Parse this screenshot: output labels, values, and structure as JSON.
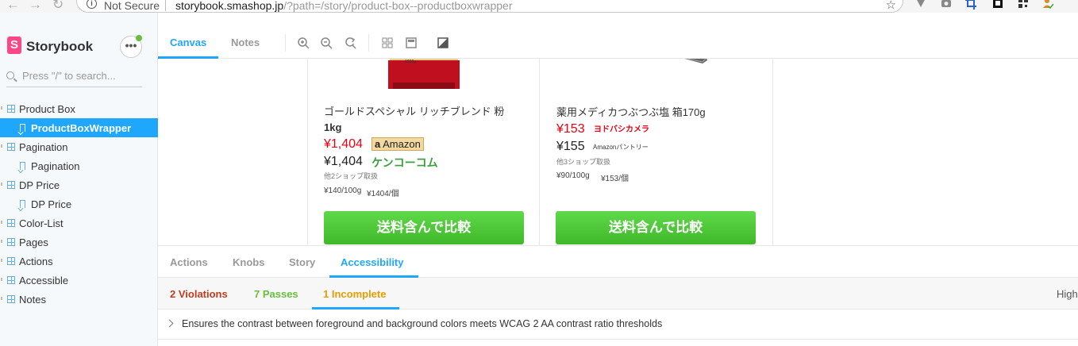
{
  "browser": {
    "security_label": "Not Secure",
    "url_host": "storybook.smashop.jp",
    "url_path": "/?path=/story/product-box--productboxwrapper"
  },
  "sidebar": {
    "title": "Storybook",
    "logo_letter": "S",
    "search_placeholder": "Press \"/\" to search...",
    "items": [
      {
        "label": "Product Box",
        "type": "component"
      },
      {
        "label": "ProductBoxWrapper",
        "type": "story",
        "active": true
      },
      {
        "label": "Pagination",
        "type": "component"
      },
      {
        "label": "Pagination",
        "type": "story"
      },
      {
        "label": "DP Price",
        "type": "component"
      },
      {
        "label": "DP Price",
        "type": "story"
      },
      {
        "label": "Color-List",
        "type": "component"
      },
      {
        "label": "Pages",
        "type": "component"
      },
      {
        "label": "Actions",
        "type": "component"
      },
      {
        "label": "Accessible",
        "type": "component"
      },
      {
        "label": "Notes",
        "type": "component"
      }
    ]
  },
  "toolbar": {
    "tabs": [
      "Canvas",
      "Notes"
    ],
    "active_tab": "Canvas"
  },
  "products": [
    {
      "name_line1": "ゴールドスペシャル リッチブレンド 粉",
      "name_line2": "1kg",
      "best_price": "¥1,404",
      "best_shop": "Amazon",
      "second_price": "¥1,404",
      "second_shop": "ケンコーコム",
      "others": "他2ショップ取扱",
      "unit_price": "¥140/100g",
      "unit_each": "¥1404/個",
      "compare_label": "送料含んで比較",
      "package_label": "1000g"
    },
    {
      "name_line1": "薬用メディカつぶつぶ塩 箱170g",
      "best_price": "¥153",
      "best_shop": "ヨドバシカメラ",
      "second_price": "¥155",
      "second_shop": "Amazonパントリー",
      "others": "他3ショップ取扱",
      "unit_price": "¥90/100g",
      "unit_each": "¥153/個",
      "compare_label": "送料含んで比較"
    }
  ],
  "addons": {
    "tabs": [
      "Actions",
      "Knobs",
      "Story",
      "Accessibility"
    ],
    "active_tab": "Accessibility",
    "a11y": {
      "violations": "2 Violations",
      "passes": "7 Passes",
      "incomplete": "1 Incomplete",
      "highlight_label": "Highl",
      "rule": "Ensures the contrast between foreground and background colors meets WCAG 2 AA contrast ratio thresholds"
    }
  },
  "colors": {
    "accent": "#1ea7fd",
    "violation": "#c23a1e",
    "pass": "#66bf3c",
    "incomplete": "#e69d00",
    "price_red": "#e60012",
    "compare_green": "#4cc936"
  }
}
